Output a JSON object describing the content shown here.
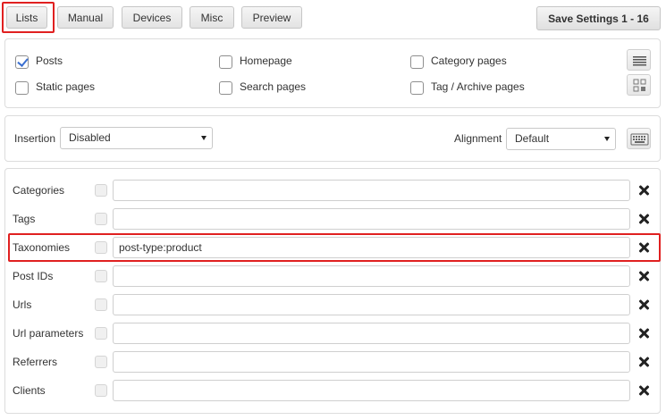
{
  "tabs": {
    "lists": "Lists",
    "manual": "Manual",
    "devices": "Devices",
    "misc": "Misc",
    "preview": "Preview"
  },
  "save_button": "Save Settings 1 - 16",
  "page_types": {
    "posts": {
      "label": "Posts",
      "checked": true
    },
    "homepage": {
      "label": "Homepage",
      "checked": false
    },
    "category_pages": {
      "label": "Category pages",
      "checked": false
    },
    "static_pages": {
      "label": "Static pages",
      "checked": false
    },
    "search_pages": {
      "label": "Search pages",
      "checked": false
    },
    "tag_archive_pages": {
      "label": "Tag / Archive pages",
      "checked": false
    }
  },
  "insertion": {
    "label": "Insertion",
    "value": "Disabled"
  },
  "alignment": {
    "label": "Alignment",
    "value": "Default"
  },
  "lists": [
    {
      "label": "Categories",
      "value": ""
    },
    {
      "label": "Tags",
      "value": ""
    },
    {
      "label": "Taxonomies",
      "value": "post-type:product"
    },
    {
      "label": "Post IDs",
      "value": ""
    },
    {
      "label": "Urls",
      "value": ""
    },
    {
      "label": "Url parameters",
      "value": ""
    },
    {
      "label": "Referrers",
      "value": ""
    },
    {
      "label": "Clients",
      "value": ""
    }
  ],
  "icons": {
    "list_view": "list-icon",
    "grid_view": "grid-icon",
    "keyboard": "keyboard-icon",
    "clear": "close-icon"
  },
  "colors": {
    "highlight": "#e02020",
    "checkbox_check": "#3a6fd0"
  }
}
